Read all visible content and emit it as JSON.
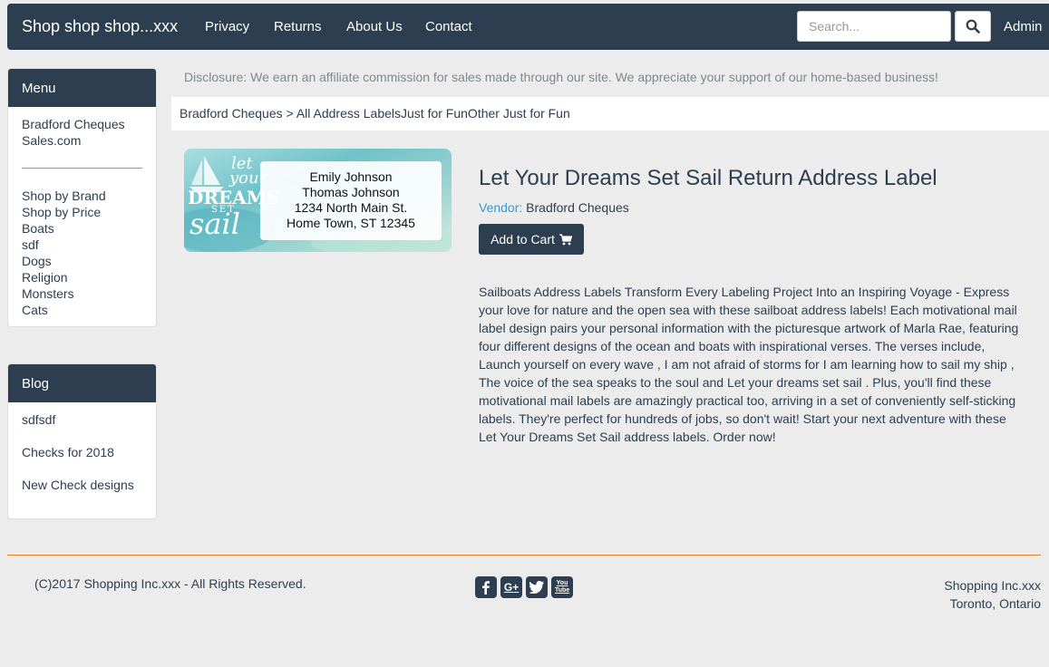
{
  "navbar": {
    "brand": "Shop shop shop...xxx",
    "links": [
      "Privacy",
      "Returns",
      "About Us",
      "Contact"
    ],
    "search_placeholder": "Search...",
    "admin": "Admin"
  },
  "sidebar": {
    "menu_title": "Menu",
    "home_link": "Bradford Cheques Sales.com",
    "items": [
      "Shop by Brand",
      "Shop by Price",
      "Boats",
      "sdf",
      "Dogs",
      "Religion",
      "Monsters",
      "Cats"
    ],
    "blog_title": "Blog",
    "blog_items": [
      "sdfsdf",
      "Checks for 2018",
      "New Check designs"
    ]
  },
  "disclosure": "Disclosure: We earn an affiliate commission for sales made through our site. We appreciate your support of our home-based business!",
  "breadcrumb": {
    "home": "Bradford Cheques",
    "separator": " > ",
    "trail": "All Address LabelsJust for FunOther Just for Fun"
  },
  "product": {
    "image": {
      "deco": [
        "let",
        "your",
        "DREAMS",
        "SET",
        "sail"
      ],
      "lines": [
        "Emily Johnson",
        "Thomas Johnson",
        "1234 North Main St.",
        "Home Town, ST 12345"
      ]
    },
    "title": "Let Your Dreams Set Sail Return Address Label",
    "vendor_label": "Vendor:",
    "vendor_name": "Bradford Cheques",
    "cart_button": "Add to Cart",
    "description": "Sailboats Address Labels Transform Every Labeling Project Into an Inspiring Voyage - Express your love for nature and the open sea with these sailboat address labels! Each motivational mail label design pairs your personal information with the picturesque artwork of Marla Rae, featuring four different designs of the ocean and boats with inspirational verses. The verses include, Launch yourself on every wave , I am not afraid of storms for I am learning how to sail my ship , The voice of the sea speaks to the soul and Let your dreams set sail . Plus, you'll find these motivational mail labels are amazingly practical too, arriving in a set of conveniently self-sticking labels. They're perfect for hundreds of jobs, so don't wait! Start your next adventure with these Let Your Dreams Set Sail address labels. Order now!"
  },
  "footer": {
    "copyright": "(C)2017 Shopping Inc.xxx - All Rights Reserved.",
    "social": [
      "facebook-icon",
      "google-plus-icon",
      "twitter-icon",
      "youtube-icon"
    ],
    "google_plus_text": "G+",
    "youtube_text": "You Tube",
    "company": "Shopping Inc.xxx",
    "location": "Toronto, Ontario"
  },
  "colors": {
    "navy": "#2c3e50",
    "accent": "#e67e22",
    "link_blue": "#3498db",
    "background": "#ececec"
  }
}
